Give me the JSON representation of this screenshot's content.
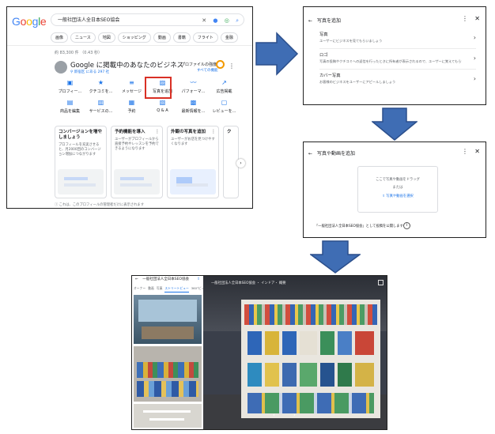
{
  "search": {
    "logo": [
      "G",
      "o",
      "o",
      "g",
      "l",
      "e"
    ],
    "query": "一般社団法人全日本SEO協会",
    "chips": [
      "画像",
      "ニュース",
      "地図",
      "ショッピング",
      "動画",
      "書籍",
      "フライト",
      "金融"
    ],
    "results": "約 83,300 件 （0.43 秒）"
  },
  "business": {
    "title": "Google に掲載中のあなたのビジネス",
    "subtitle": "新宿区 にある 297 社",
    "strength_label": "プロファイルの強度",
    "strength_link": "すべての機能",
    "actions": [
      {
        "icon": "store-icon",
        "glyph": "▣",
        "label": "プロフィー..."
      },
      {
        "icon": "review-icon",
        "glyph": "★",
        "label": "クチコミを..."
      },
      {
        "icon": "message-icon",
        "glyph": "≡",
        "label": "メッセージ"
      },
      {
        "icon": "photo-icon",
        "glyph": "▨",
        "label": "写真を追加"
      },
      {
        "icon": "performance-icon",
        "glyph": "〰",
        "label": "パフォーマ..."
      },
      {
        "icon": "ads-icon",
        "glyph": "↗",
        "label": "広告掲載"
      },
      {
        "icon": "product-icon",
        "glyph": "▤",
        "label": "商品を編集"
      },
      {
        "icon": "service-icon",
        "glyph": "▥",
        "label": "サービスの..."
      },
      {
        "icon": "booking-icon",
        "glyph": "▦",
        "label": "予約"
      },
      {
        "icon": "qa-icon",
        "glyph": "▧",
        "label": "Q & A"
      },
      {
        "icon": "post-icon",
        "glyph": "▩",
        "label": "最新情報を..."
      },
      {
        "icon": "request-icon",
        "glyph": "▢",
        "label": "レビューを..."
      }
    ],
    "cards": [
      {
        "title": "コンバージョンを増やしましょう",
        "desc": "プロフィールを充実させると、月2000回のコンバージョン増加につながります"
      },
      {
        "title": "予約機能を導入",
        "desc": "ユーザーがプロフィールから直接予約やレッスンを予約できるようになります"
      },
      {
        "title": "外観の写真を追加",
        "desc": "ユーザーがお店を見つけやすくなります"
      },
      {
        "title": "ク",
        "desc": ""
      }
    ],
    "footnote": "これは、このプロフィールの管理者だけに表示されます"
  },
  "add_photo_dialog": {
    "title": "写真を追加",
    "options": [
      {
        "label": "写真",
        "desc": "ユーザーにビジネスを見てもらいましょう"
      },
      {
        "label": "ロゴ",
        "desc": "写真の投稿やクチコミへの返信を行ったときに所有者が表示されるので、ユーザーに覚えてもらいましょう"
      },
      {
        "label": "カバー写真",
        "desc": "お客様のビジネスをユーザーにアピールしましょう"
      }
    ]
  },
  "upload_dialog": {
    "title": "写真や動画を追加",
    "drop_text": "ここで写真や動画をドラッグ",
    "or_text": "または",
    "select_link": "写真や動画を選択",
    "note": "「一般社団法人全日本SEO協会」として投稿を公開します"
  },
  "street_view": {
    "title": "一般社団法人全日本SEO協会",
    "tabs": [
      "オーナー",
      "動画",
      "写真",
      "ストリートビュー",
      "360°ビュー"
    ],
    "active_tab": 3,
    "caption": "一般社団法人全日本SEO協会 ・ インドア・ 概要"
  },
  "colors": {
    "accent": "#1a73e8",
    "highlight": "#d93025",
    "arrow": "#3f6db4",
    "arrow_stroke": "#2b4f8c"
  }
}
